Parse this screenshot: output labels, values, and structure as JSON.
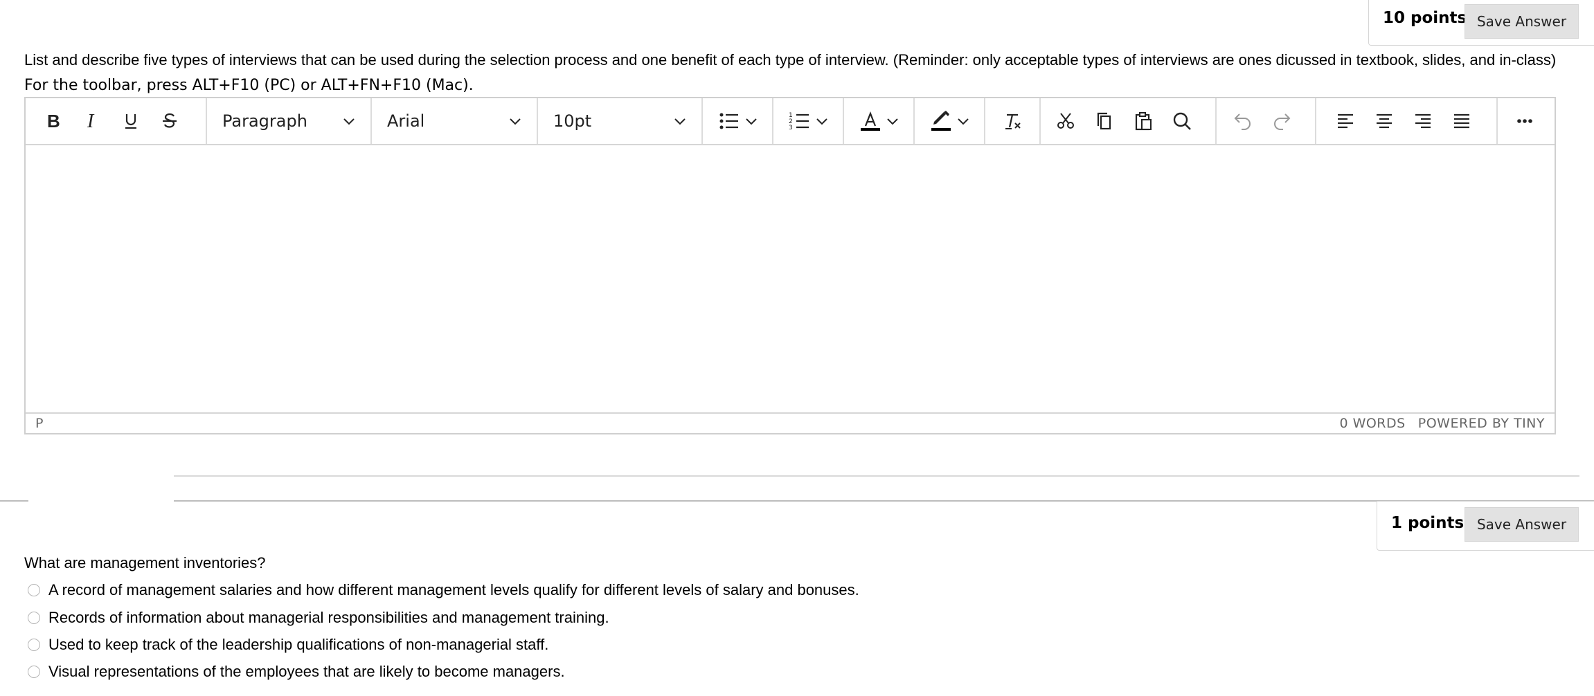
{
  "q1": {
    "points": "10 points",
    "save_label": "Save Answer",
    "prompt": "List and describe five types of interviews that can be used during the selection process and one benefit of each type of interview. (Reminder: only acceptable types of interviews are ones dicussed in textbook, slides, and in-class)",
    "toolbar_hint": "For the toolbar, press ALT+F10 (PC) or ALT+FN+F10 (Mac)."
  },
  "editor": {
    "block_format": "Paragraph",
    "font_family": "Arial",
    "font_size": "10pt",
    "path": "P",
    "word_count": "0 WORDS",
    "powered_by": "POWERED BY TINY",
    "icons": [
      "bold-icon",
      "italic-icon",
      "underline-icon",
      "strikethrough-icon",
      "bullet-list-icon",
      "numbered-list-icon",
      "text-color-icon",
      "highlight-icon",
      "clear-format-icon",
      "cut-icon",
      "copy-icon",
      "paste-icon",
      "search-icon",
      "undo-icon",
      "redo-icon",
      "align-left-icon",
      "align-center-icon",
      "align-right-icon",
      "justify-icon",
      "more-icon"
    ],
    "text_color": "#000000",
    "highlight_color": "#000000"
  },
  "q2": {
    "points": "1 points",
    "save_label": "Save Answer",
    "prompt": "What are management inventories?",
    "options": [
      "A record of management salaries and how different management levels qualify for different levels of salary and bonuses.",
      "Records of information about managerial responsibilities and management training.",
      "Used to keep track of the leadership qualifications of non-managerial staff.",
      "Visual representations of the employees that are likely to become managers."
    ]
  }
}
